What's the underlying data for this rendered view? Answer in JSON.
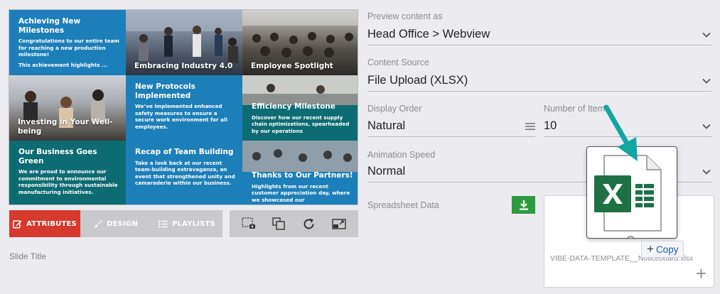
{
  "preview": {
    "tiles": [
      {
        "title": "Achieving New Milestones",
        "body": "Congratulations to our entire team for reaching a new production milestone!",
        "extra": "This achievement highlights ..."
      },
      {
        "caption": "Embracing Industry 4.0"
      },
      {
        "caption": "Employee Spotlight"
      },
      {
        "caption": "Investing in Your Well-being"
      },
      {
        "title": "New Protocols Implemented",
        "body": "We’ve implemented enhanced safety measures to ensure a secure work environment for all employees."
      },
      {
        "title": "Efficiency Milestone",
        "body": "Discover how our recent supply chain optimizations, spearheaded by our operations"
      },
      {
        "title": "Our Business Goes Green",
        "body": "We are proud to announce our commitment to environmental responsibility through sustainable manufacturing initiatives."
      },
      {
        "title": "Recap of Team Building",
        "body": "Take a look back at our recent team-building extravaganza, an event that strengthened unity and camaraderie within our business."
      },
      {
        "title": "Thanks to Our Partners!",
        "body": "Highlights from our recent customer appreciation day, where we showcased our"
      }
    ]
  },
  "tabs": {
    "attributes": "ATTRIBUTES",
    "design": "DESIGN",
    "playlists": "PLAYLISTS"
  },
  "slide_title_label": "Slide Title",
  "form": {
    "preview_as_label": "Preview content as",
    "preview_as_value": "Head Office > Webview",
    "content_source_label": "Content Source",
    "content_source_value": "File Upload (XLSX)",
    "display_order_label": "Display Order",
    "display_order_value": "Natural",
    "number_items_label": "Number of Items",
    "number_items_value": "10",
    "animation_speed_label": "Animation Speed",
    "animation_speed_value": "Normal",
    "spreadsheet_label": "Spreadsheet Data",
    "file_name": "VIBE-DATA-TEMPLATE__Noticeboard.xlsx"
  },
  "drag": {
    "copy_label": "Copy"
  },
  "colors": {
    "accent_red": "#d63a2e",
    "download_green": "#2e9a3e",
    "arrow_teal": "#12a6a3",
    "excel_green": "#1e7145"
  }
}
